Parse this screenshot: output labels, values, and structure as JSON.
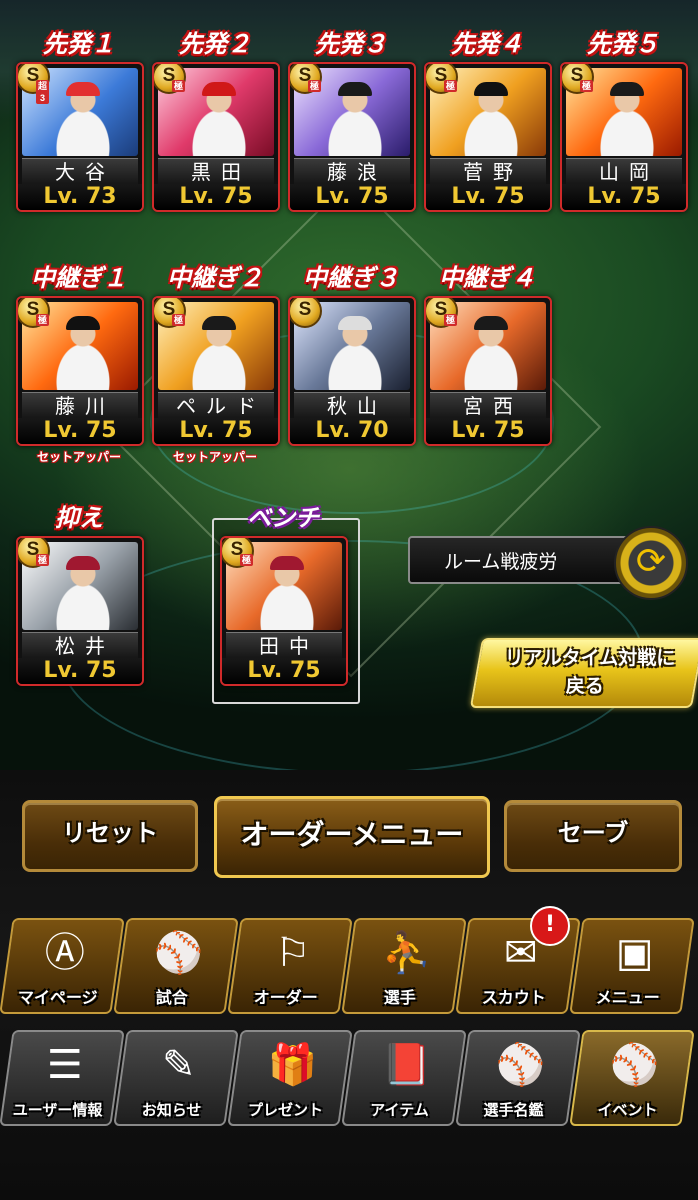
{
  "rotation": [
    {
      "slot": "先発１",
      "name": "大谷",
      "level": "Lv. 73",
      "rank": "S",
      "rank_sub": "超3",
      "photo": "ph-blue",
      "cap": "#e23030"
    },
    {
      "slot": "先発２",
      "name": "黒田",
      "level": "Lv. 75",
      "rank": "S",
      "rank_sub": "極",
      "photo": "ph-red",
      "cap": "#d01818"
    },
    {
      "slot": "先発３",
      "name": "藤浪",
      "level": "Lv. 75",
      "rank": "S",
      "rank_sub": "極",
      "photo": "ph-purple",
      "cap": "#1a1a1a"
    },
    {
      "slot": "先発４",
      "name": "菅野",
      "level": "Lv. 75",
      "rank": "S",
      "rank_sub": "極",
      "photo": "ph-gold",
      "cap": "#111"
    },
    {
      "slot": "先発５",
      "name": "山岡",
      "level": "Lv. 75",
      "rank": "S",
      "rank_sub": "極",
      "photo": "ph-fire",
      "cap": "#1a1a1a"
    }
  ],
  "relievers": [
    {
      "slot": "中継ぎ１",
      "name": "藤川",
      "level": "Lv. 75",
      "rank": "S",
      "rank_sub": "極",
      "role": "セットアッパー",
      "photo": "ph-fire",
      "cap": "#111"
    },
    {
      "slot": "中継ぎ２",
      "name": "ペルドモ",
      "level": "Lv. 75",
      "rank": "S",
      "rank_sub": "極",
      "role": "セットアッパー",
      "photo": "ph-gold",
      "cap": "#1a1a1a"
    },
    {
      "slot": "中継ぎ３",
      "name": "秋山",
      "level": "Lv. 70",
      "rank": "S",
      "rank_sub": "",
      "role": "",
      "photo": "ph-storm",
      "cap": "#ddd"
    },
    {
      "slot": "中継ぎ４",
      "name": "宮西",
      "level": "Lv. 75",
      "rank": "S",
      "rank_sub": "極",
      "role": "",
      "photo": "ph-orange",
      "cap": "#1a1a1a"
    }
  ],
  "closer": {
    "slot": "抑え",
    "name": "松井",
    "level": "Lv. 75",
    "rank": "S",
    "rank_sub": "極",
    "photo": "ph-gray",
    "cap": "#a01830"
  },
  "bench": {
    "slot": "ベンチ",
    "name": "田中",
    "level": "Lv. 75",
    "rank": "S",
    "rank_sub": "極",
    "photo": "ph-orange",
    "cap": "#a01830"
  },
  "side": {
    "fatigue_label": "ルーム戦疲労",
    "fatigue_icon": "⟳",
    "realtime_line1": "リアルタイム対戦に",
    "realtime_line2": "戻る"
  },
  "controls": {
    "reset": "リセット",
    "order_menu": "オーダーメニュー",
    "save": "セーブ"
  },
  "nav_main": [
    {
      "label": "マイページ",
      "icon": "Ⓐ",
      "name": "mypage"
    },
    {
      "label": "試合",
      "icon": "⚾",
      "name": "match"
    },
    {
      "label": "オーダー",
      "icon": "⚐",
      "name": "order"
    },
    {
      "label": "選手",
      "icon": "⛹",
      "name": "players"
    },
    {
      "label": "スカウト",
      "icon": "✉",
      "name": "scout"
    },
    {
      "label": "メニュー",
      "icon": "▣",
      "name": "menu"
    }
  ],
  "scout_badge": "!",
  "nav_sub": [
    {
      "label": "ユーザー情報",
      "icon": "☰",
      "name": "user-info"
    },
    {
      "label": "お知らせ",
      "icon": "✎",
      "name": "news"
    },
    {
      "label": "プレゼント",
      "icon": "🎁",
      "name": "present"
    },
    {
      "label": "アイテム",
      "icon": "📕",
      "name": "item"
    },
    {
      "label": "選手名鑑",
      "icon": "⚾",
      "name": "directory"
    },
    {
      "label": "イベント",
      "icon": "⚾",
      "name": "event"
    }
  ]
}
